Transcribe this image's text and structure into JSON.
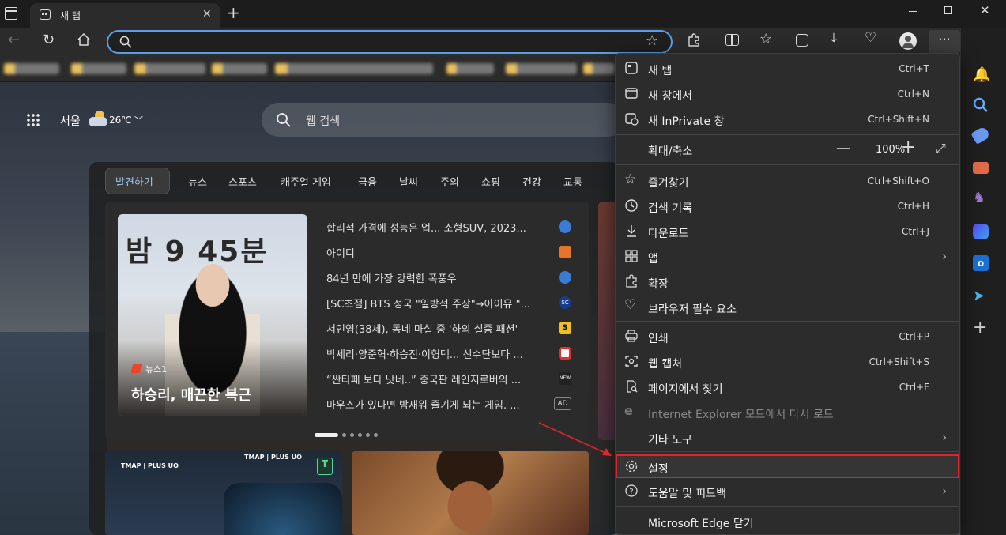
{
  "tab": {
    "title": "새 탭"
  },
  "address": {
    "value": "",
    "placeholder": ""
  },
  "ntp": {
    "location": "서울",
    "temperature": "26℃",
    "search_placeholder": "웹 검색",
    "nav": [
      "발견하기",
      "뉴스",
      "스포츠",
      "캐주얼 게임",
      "금융",
      "날씨",
      "주의",
      "쇼핑",
      "건강",
      "교통"
    ],
    "hero": {
      "source": "뉴스1",
      "caption": "하승리, 매끈한 복근",
      "backdrop_text": "밤 9 45분"
    },
    "news": [
      {
        "title": "합리적 가격에 성능은 업... 소형SUV, 2023...",
        "src_color": "#3a7bd5"
      },
      {
        "title": "아이디",
        "src_color": "#e8742a"
      },
      {
        "title": "84년 만에 가장 강력한 폭풍우",
        "src_color": "#3a7bd5"
      },
      {
        "title": "[SC초점] BTS 정국 \"일방적 주장\"→아이유 \"...",
        "src_color": "#1a3a8a",
        "src_label": "SC"
      },
      {
        "title": "서인영(38세), 동네 마실 중 '하의 실종 패션'",
        "src_color": "#f0c020",
        "src_label": "S"
      },
      {
        "title": "박세리·양준혁·하승진·이형택... 선수단보다 ...",
        "src_color": "#e03030"
      },
      {
        "title": "“싼타페 보다 낫네..” 중국판 레인지로버의 ...",
        "src_color": "#222222",
        "src_label": "NEW"
      },
      {
        "title": "마우스가 있다면 밤새워 즐기게 되는 게임. ...",
        "badge": "AD"
      }
    ],
    "card1_text": "TMAP | PLUS UO"
  },
  "menu": {
    "items": [
      {
        "label": "새 탭",
        "shortcut": "Ctrl+T"
      },
      {
        "label": "새 창에서",
        "shortcut": "Ctrl+N"
      },
      {
        "label": "새 InPrivate 창",
        "shortcut": "Ctrl+Shift+N"
      },
      {
        "label": "확대/축소",
        "zoom": "100%"
      },
      {
        "label": "즐겨찾기",
        "shortcut": "Ctrl+Shift+O"
      },
      {
        "label": "검색 기록",
        "shortcut": "Ctrl+H"
      },
      {
        "label": "다운로드",
        "shortcut": "Ctrl+J"
      },
      {
        "label": "앱"
      },
      {
        "label": "확장"
      },
      {
        "label": "브라우저 필수 요소"
      },
      {
        "label": "인쇄",
        "shortcut": "Ctrl+P"
      },
      {
        "label": "웹 캡처",
        "shortcut": "Ctrl+Shift+S"
      },
      {
        "label": "페이지에서 찾기",
        "shortcut": "Ctrl+F"
      },
      {
        "label": "Internet Explorer 모드에서 다시 로드"
      },
      {
        "label": "기타 도구"
      },
      {
        "label": "설정"
      },
      {
        "label": "도움말 및 피드백"
      },
      {
        "label": "Microsoft Edge 닫기"
      }
    ]
  },
  "colors": {
    "highlight": "#e0242b",
    "accent": "#5a9fe6",
    "menu_bg": "#2c2c2c"
  }
}
